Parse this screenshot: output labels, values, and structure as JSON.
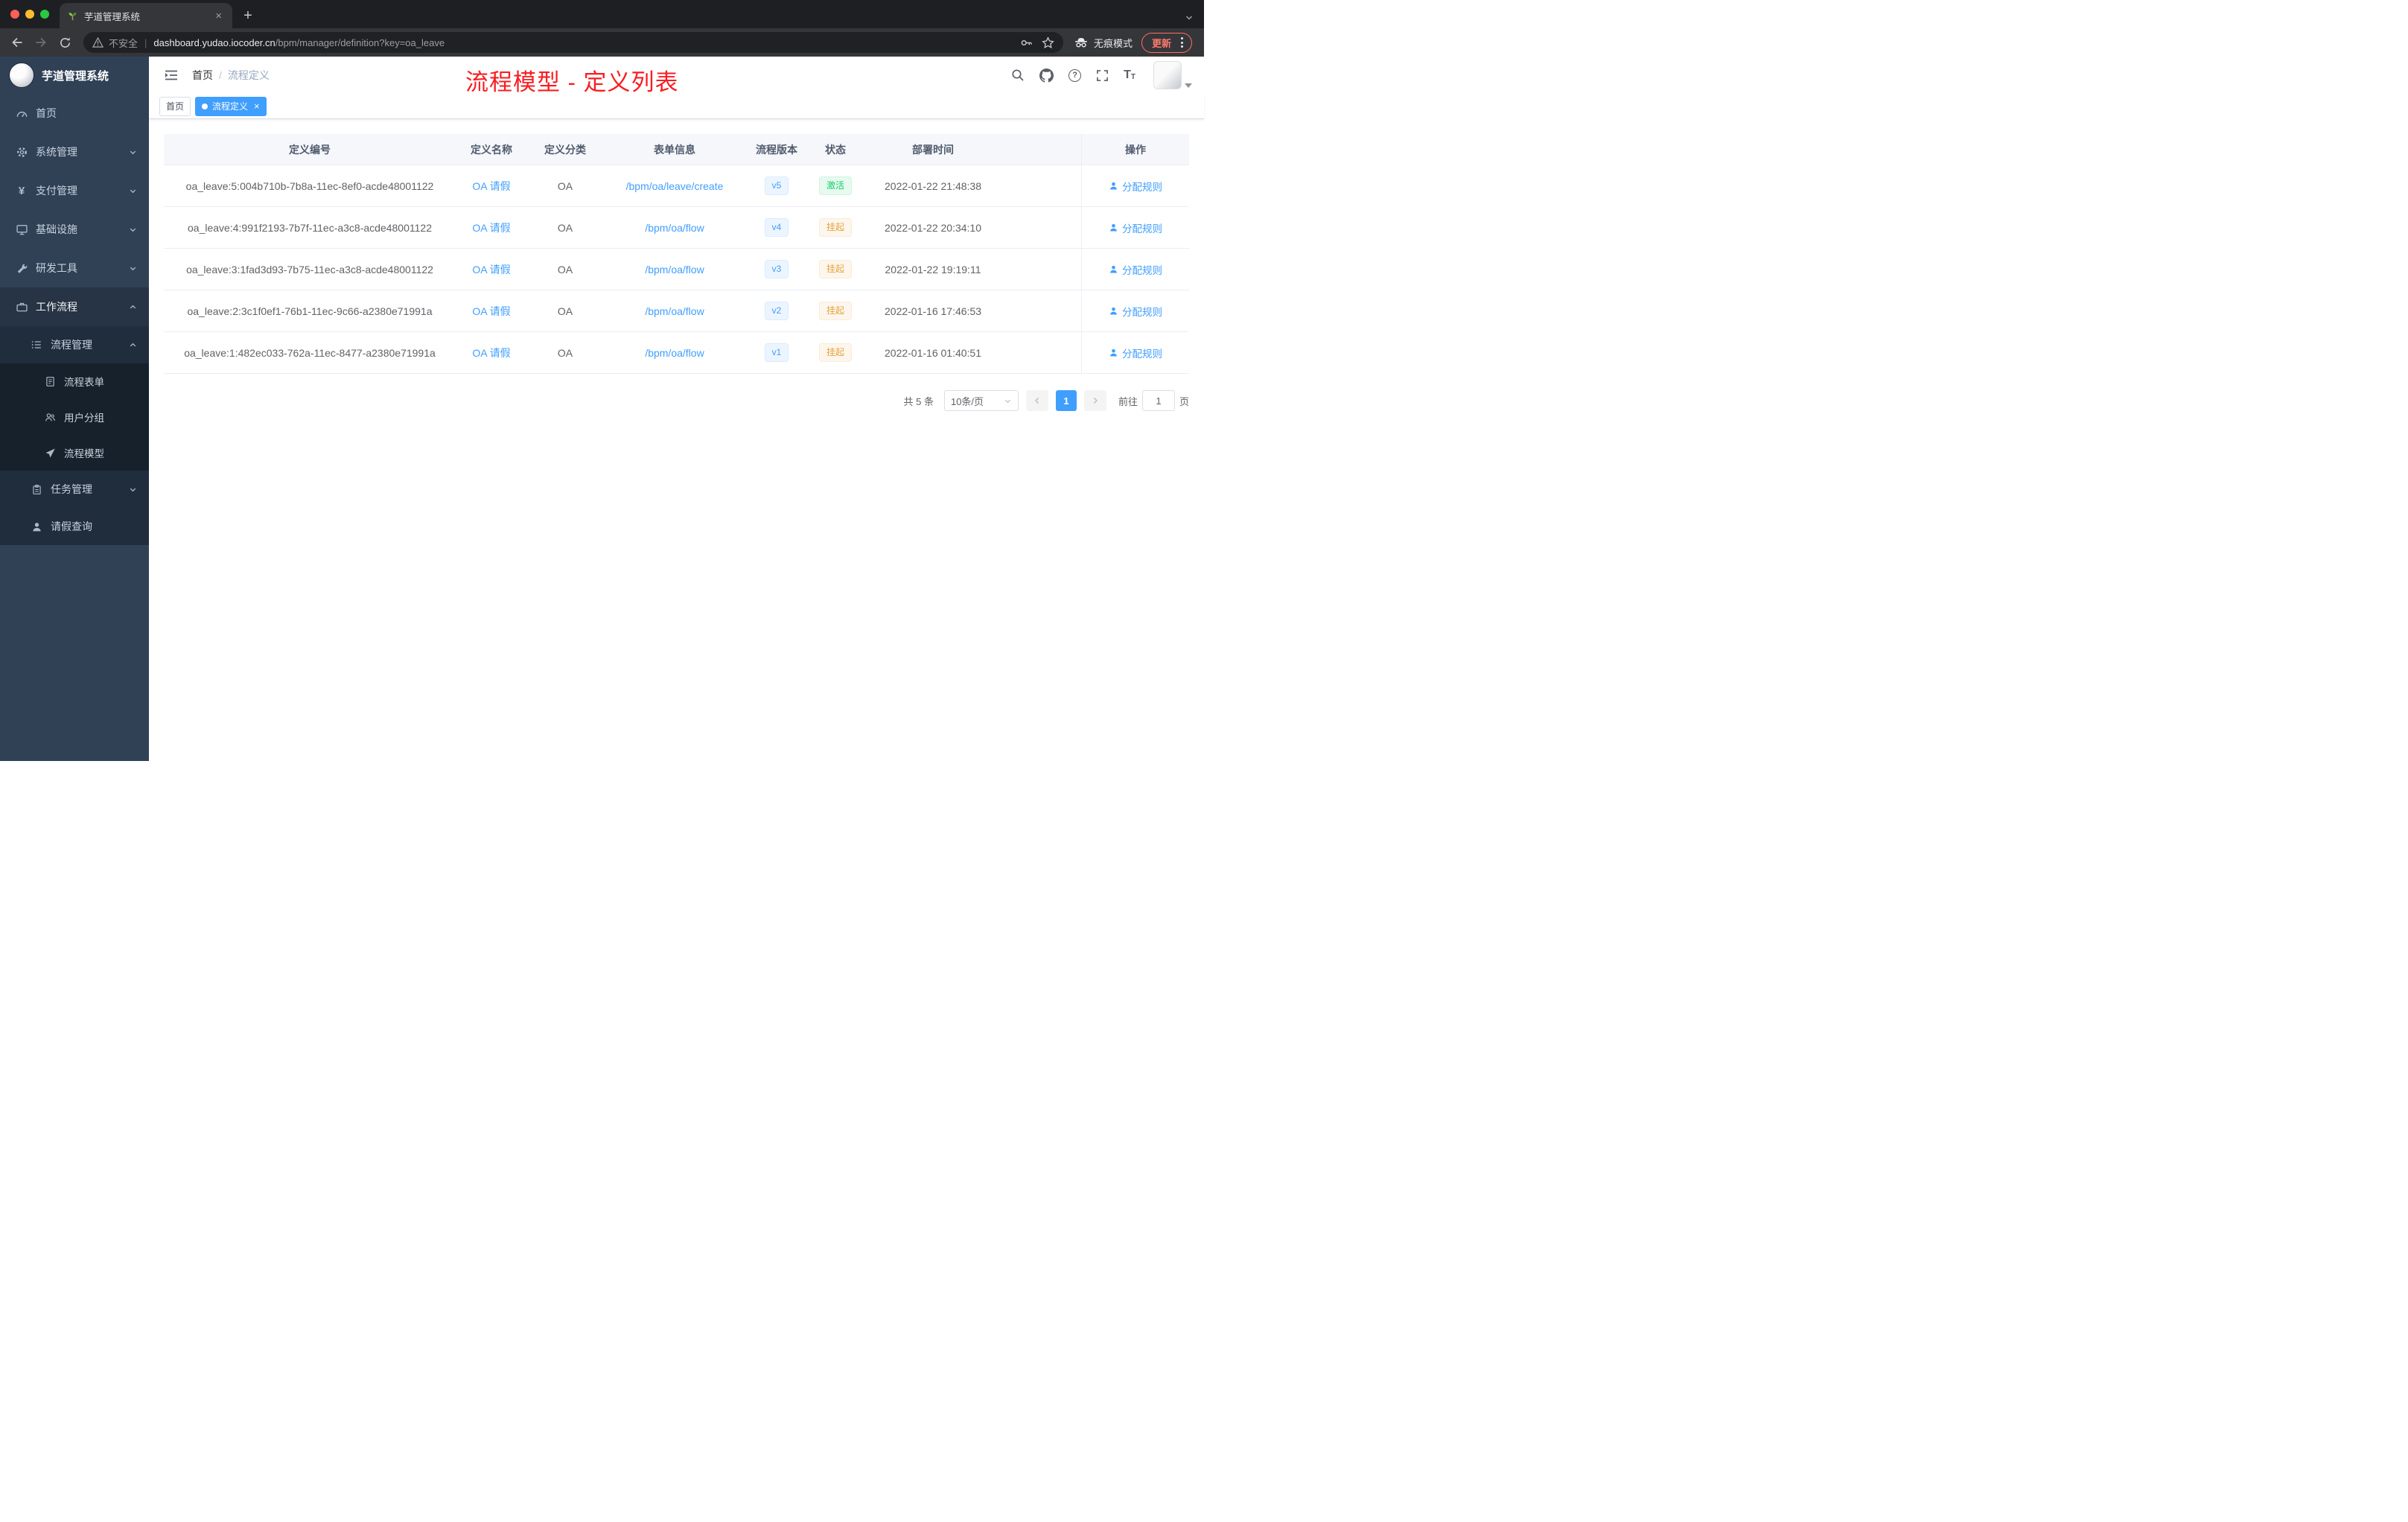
{
  "browser": {
    "tab_title": "芋道管理系统",
    "security": "不安全",
    "url_host": "dashboard.yudao.iocoder.cn",
    "url_path": "/bpm/manager/definition?key=oa_leave",
    "incognito": "无痕模式",
    "update": "更新"
  },
  "sidebar": {
    "title": "芋道管理系统",
    "items": [
      {
        "label": "首页"
      },
      {
        "label": "系统管理"
      },
      {
        "label": "支付管理"
      },
      {
        "label": "基础设施"
      },
      {
        "label": "研发工具"
      },
      {
        "label": "工作流程"
      },
      {
        "label": "流程管理"
      },
      {
        "label": "流程表单"
      },
      {
        "label": "用户分组"
      },
      {
        "label": "流程模型"
      },
      {
        "label": "任务管理"
      },
      {
        "label": "请假查询"
      }
    ]
  },
  "header": {
    "breadcrumb_home": "首页",
    "breadcrumb_sep": "/",
    "breadcrumb_current": "流程定义",
    "overlay_title": "流程模型 - 定义列表"
  },
  "tags": {
    "home": "首页",
    "current": "流程定义"
  },
  "table": {
    "headers": [
      "定义编号",
      "定义名称",
      "定义分类",
      "表单信息",
      "流程版本",
      "状态",
      "部署时间",
      "操作"
    ],
    "rows": [
      {
        "id": "oa_leave:5:004b710b-7b8a-11ec-8ef0-acde48001122",
        "name": "OA 请假",
        "category": "OA",
        "form": "/bpm/oa/leave/create",
        "version": "v5",
        "status": "激活",
        "status_type": "success",
        "time": "2022-01-22 21:48:38",
        "action": "分配规则"
      },
      {
        "id": "oa_leave:4:991f2193-7b7f-11ec-a3c8-acde48001122",
        "name": "OA 请假",
        "category": "OA",
        "form": "/bpm/oa/flow",
        "version": "v4",
        "status": "挂起",
        "status_type": "warning",
        "time": "2022-01-22 20:34:10",
        "action": "分配规则"
      },
      {
        "id": "oa_leave:3:1fad3d93-7b75-11ec-a3c8-acde48001122",
        "name": "OA 请假",
        "category": "OA",
        "form": "/bpm/oa/flow",
        "version": "v3",
        "status": "挂起",
        "status_type": "warning",
        "time": "2022-01-22 19:19:11",
        "action": "分配规则"
      },
      {
        "id": "oa_leave:2:3c1f0ef1-76b1-11ec-9c66-a2380e71991a",
        "name": "OA 请假",
        "category": "OA",
        "form": "/bpm/oa/flow",
        "version": "v2",
        "status": "挂起",
        "status_type": "warning",
        "time": "2022-01-16 17:46:53",
        "action": "分配规则"
      },
      {
        "id": "oa_leave:1:482ec033-762a-11ec-8477-a2380e71991a",
        "name": "OA 请假",
        "category": "OA",
        "form": "/bpm/oa/flow",
        "version": "v1",
        "status": "挂起",
        "status_type": "warning",
        "time": "2022-01-16 01:40:51",
        "action": "分配规则"
      }
    ]
  },
  "pagination": {
    "total": "共 5 条",
    "page_size": "10条/页",
    "current_page": "1",
    "goto_label": "前往",
    "goto_value": "1",
    "page_unit": "页"
  },
  "colors": {
    "accent_blue": "#409eff",
    "success_green": "#13ce66",
    "warning_orange": "#e6a23c",
    "annotation_red": "#f81d22",
    "sidebar_bg": "#304156"
  }
}
